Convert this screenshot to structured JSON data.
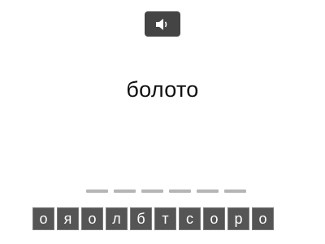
{
  "audio": {
    "icon": "speaker-icon"
  },
  "prompt": {
    "word": "болото"
  },
  "answer": {
    "slot_count": 6
  },
  "letter_tiles": [
    "о",
    "я",
    "о",
    "л",
    "б",
    "т",
    "с",
    "о",
    "р",
    "о"
  ]
}
